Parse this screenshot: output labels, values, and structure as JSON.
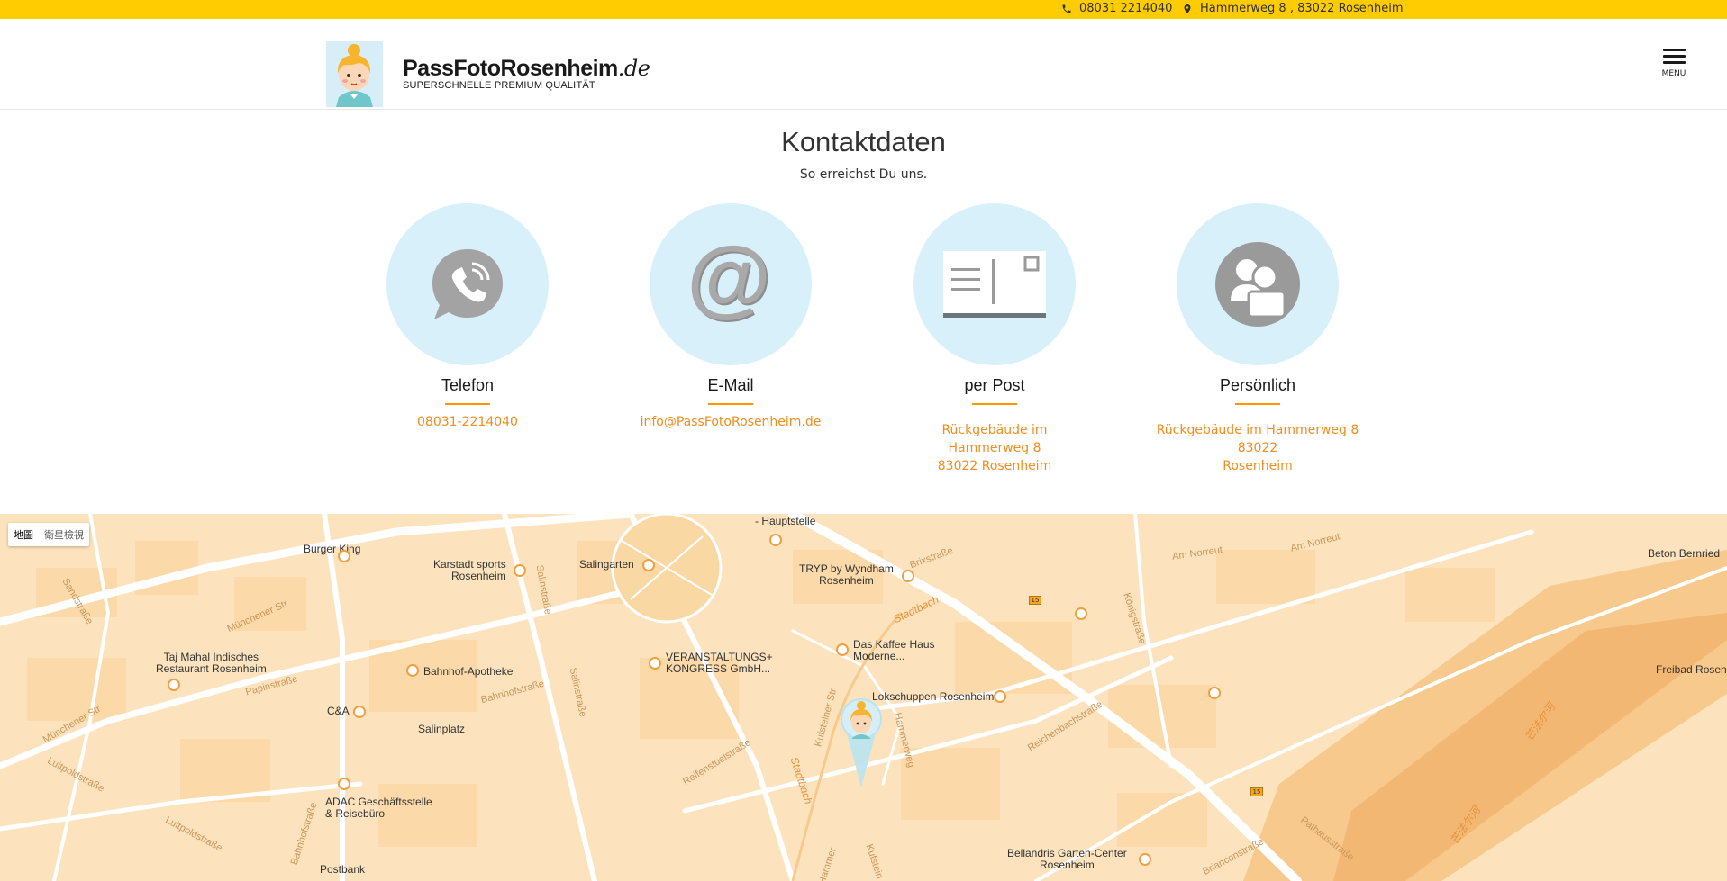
{
  "topbar": {
    "phone": "08031 2214040",
    "address": "Hammerweg 8 , 83022 Rosenheim"
  },
  "header": {
    "logo_title": "PassFotoRosenheim",
    "logo_tld": ".de",
    "logo_subtitle": "SUPERSCHNELLE PREMIUM QUALITÄT",
    "menu_label": "MENU"
  },
  "section": {
    "title": "Kontaktdaten",
    "subtitle": "So erreichst Du uns."
  },
  "cards": [
    {
      "title": "Telefon",
      "lines": [
        "08031-2214040"
      ],
      "icon": "phone-icon"
    },
    {
      "title": "E-Mail",
      "lines": [
        "info@PassFotoRosenheim.de"
      ],
      "icon": "at-icon"
    },
    {
      "title": "per Post",
      "lines": [
        "Rückgebäude im",
        "Hammerweg 8",
        "83022 Rosenheim"
      ],
      "icon": "postcard-icon"
    },
    {
      "title": "Persönlich",
      "lines": [
        "Rückgebäude im Hammerweg 8 83022",
        "Rosenheim"
      ],
      "icon": "person-icon"
    }
  ],
  "map": {
    "toggle": [
      "地圖",
      "衛星檢視"
    ],
    "labels": {
      "burger_king": "Burger King",
      "karstadt_1": "Karstadt sports",
      "karstadt_2": "Rosenheim",
      "salingarten": "Salingarten",
      "hauptstelle": "- Hauptstelle",
      "tryp_1": "TRYP by Wyndham",
      "tryp_2": "Rosenheim",
      "taj_1": "Taj Mahal Indisches",
      "taj_2": "Restaurant Rosenheim",
      "apotheke": "Bahnhof-Apotheke",
      "vk_1": "VERANSTALTUNGS+",
      "vk_2": "KONGRESS GmbH...",
      "kaffee_1": "Das Kaffee Haus",
      "kaffee_2": "Moderne...",
      "lokschuppen": "Lokschuppen Rosenheim",
      "ca": "C&A",
      "salinplatz": "Salinplatz",
      "adac_1": "ADAC Geschäftsstelle",
      "adac_2": "& Reisebüro",
      "postbank": "Postbank",
      "bellandris_1": "Bellandris Garten-Center",
      "bellandris_2": "Rosenheim",
      "beton": "Beton Bernried",
      "freibad": "Freibad Rosenh",
      "am_norreut_1": "Am Norreut",
      "am_norreut_2": "Am Norreut",
      "brixstrasse": "Brixstraße",
      "stadtbach_1": "Stadtbach",
      "stadtbach_2": "Stadtbach",
      "koenigstrasse": "Königstraße",
      "sandstrasse": "Sandstraße",
      "muenchener_1": "Münchener Str",
      "muenchener_2": "Münchener Str",
      "papinstrasse": "Papinstraße",
      "salinstrasse_1": "Salinstraße",
      "salinstrasse_2": "Salinstraße",
      "bahnhofstrasse_1": "Bahnhofstraße",
      "bahnhofstrasse_2": "Bahnhofstraße",
      "luitpold_1": "Luitpoldstraße",
      "luitpold_2": "Luitpoldstraße",
      "reifenstuel": "Reifenstuelstraße",
      "kufsteiner_1": "Kufsteiner Str",
      "kufsteiner_2": "Kufstein",
      "hammerweg": "Hammerweg",
      "reichenbach": "Reichenbachstraße",
      "brianconstr": "Brianconstraße",
      "pathaus": "Pathausstraße",
      "hammer": "Hammer",
      "river_1": "芒法尔河",
      "river_2": "芒法尔河",
      "route": "15"
    }
  }
}
